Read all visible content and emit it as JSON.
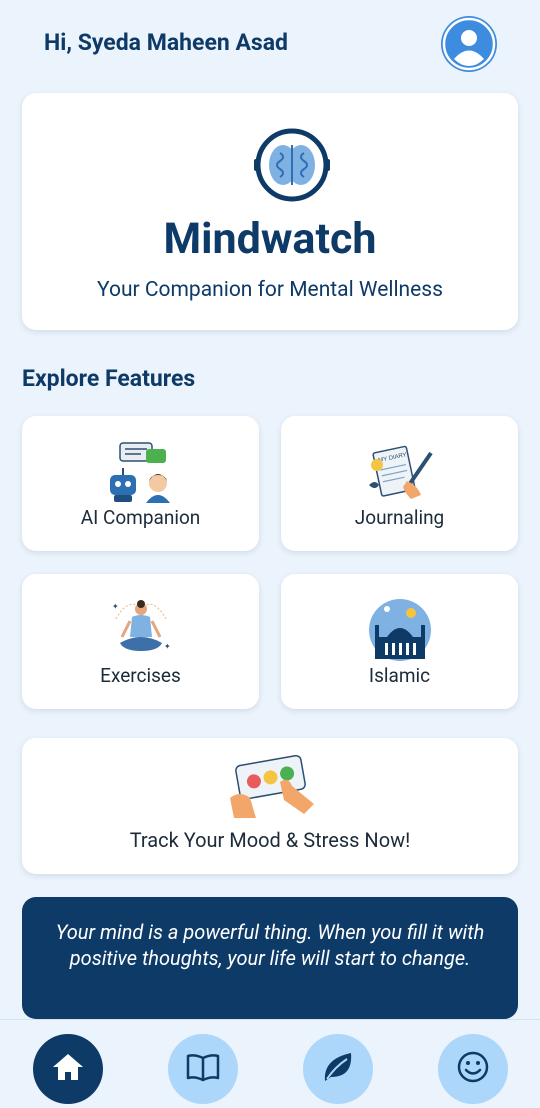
{
  "header": {
    "greeting": "Hi, Syeda Maheen Asad",
    "avatar_icon": "user-profile-icon"
  },
  "hero": {
    "icon": "brain-icon",
    "title": "Mindwatch",
    "subtitle": "Your Companion for Mental Wellness"
  },
  "features": {
    "section_title": "Explore Features",
    "items": [
      {
        "label": "AI Companion",
        "icon": "ai-chat-icon"
      },
      {
        "label": "Journaling",
        "icon": "diary-icon"
      },
      {
        "label": "Exercises",
        "icon": "meditation-icon"
      },
      {
        "label": "Islamic",
        "icon": "mosque-icon"
      }
    ]
  },
  "mood": {
    "label": "Track Your Mood & Stress Now!",
    "icon": "mood-faces-icon"
  },
  "quote": {
    "text": "Your mind is a powerful thing. When you fill it with positive thoughts, your life will start to change."
  },
  "nav": {
    "items": [
      {
        "icon": "home-icon",
        "active": true
      },
      {
        "icon": "book-icon",
        "active": false
      },
      {
        "icon": "leaf-icon",
        "active": false
      },
      {
        "icon": "smiley-icon",
        "active": false
      }
    ]
  },
  "colors": {
    "primary": "#0d3a66",
    "background": "#ebf3fc",
    "nav_button": "#acd6fa",
    "avatar": "#3d8ce0"
  }
}
